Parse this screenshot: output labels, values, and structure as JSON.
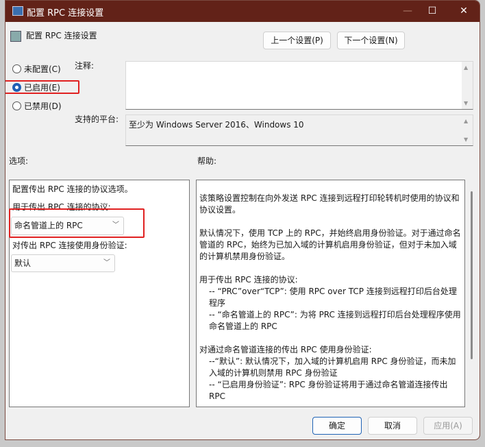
{
  "window": {
    "title": "配置 RPC 连接设置",
    "minimize": "—",
    "maximize": "☐",
    "close": "✕"
  },
  "header": {
    "title": "配置 RPC 连接设置",
    "prev_button": "上一个设置(P)",
    "next_button": "下一个设置(N)"
  },
  "state": {
    "options": [
      {
        "label": "未配置(C)",
        "selected": false
      },
      {
        "label": "已启用(E)",
        "selected": true
      },
      {
        "label": "已禁用(D)",
        "selected": false
      }
    ]
  },
  "comment": {
    "label": "注释:",
    "value": ""
  },
  "platform": {
    "label": "支持的平台:",
    "value": "至少为 Windows Server 2016、Windows 10"
  },
  "options_section": {
    "label": "选项:",
    "description": "配置传出 RPC 连接的协议选项。",
    "protocol_label": "用于传出 RPC 连接的协议:",
    "protocol_value": "命名管道上的 RPC",
    "auth_label": "对传出 RPC 连接使用身份验证:",
    "auth_value": "默认"
  },
  "help_section": {
    "label": "帮助:",
    "paragraphs": [
      "该策略设置控制在向外发送 RPC 连接到远程打印轮转机时使用的协议和协议设置。",
      "默认情况下，使用 TCP 上的 RPC，并始终启用身份验证。对于通过命名管道的 RPC，始终为已加入域的计算机启用身份验证，但对于未加入域的计算机禁用身份验证。",
      "用于传出 RPC 连接的协议:",
      "-- “PRC”over“TCP”: 使用 RPC over TCP 连接到远程打印后台处理程序",
      "-- “命名管道上的 RPC”: 为将 PRC 连接到远程打印后台处理程序使用命名管道上的 RPC",
      "对通过命名管道连接的传出 RPC 使用身份验证:",
      "--“默认”: 默认情况下，加入域的计算机启用 RPC 身份验证，而未加入域的计算机则禁用 RPC 身份验证",
      "-- “已启用身份验证”: RPC 身份验证将用于通过命名管道连接传出 RPC"
    ]
  },
  "footer": {
    "ok": "确定",
    "cancel": "取消",
    "apply": "应用(A)"
  }
}
